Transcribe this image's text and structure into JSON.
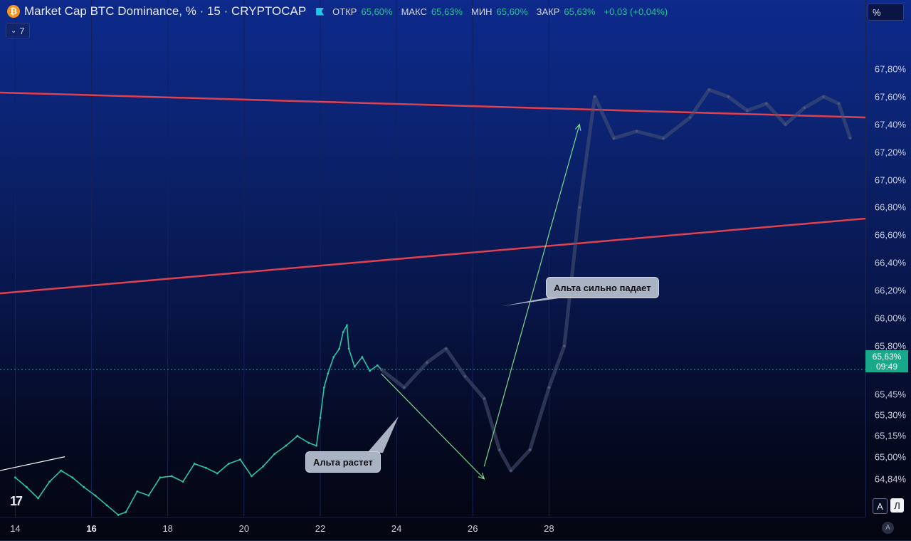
{
  "header": {
    "symbol_icon": "bitcoin-icon",
    "title": "Market Cap BTC Dominance, % · 15 · CRYPTOCAP",
    "open_label": "ОТКР",
    "open_value": "65,60%",
    "high_label": "МАКС",
    "high_value": "65,63%",
    "low_label": "МИН",
    "low_value": "65,60%",
    "close_label": "ЗАКР",
    "close_value": "65,63%",
    "change_value": "+0,03 (+0,04%)"
  },
  "indicators": {
    "count": "7",
    "toggle_icon": "chevron-down-icon"
  },
  "price_scale": {
    "unit_button": "%",
    "current_price": "65,63%",
    "countdown": "09:49",
    "auto_label": "A",
    "scale_buttons": [
      "A",
      "Л"
    ]
  },
  "annotations": {
    "alt_falls": "Альта сильно падает",
    "alt_rises": "Альта растет"
  },
  "colors": {
    "candle": "#2bc7a4",
    "projection": "#4a5577",
    "trendline": "#e0414f",
    "arrow": "#7ed98f",
    "price_tag": "#18a98a"
  },
  "chart_data": {
    "type": "line",
    "series": [
      {
        "values": [
          [
            14,
            64.85
          ],
          [
            14.3,
            64.78
          ],
          [
            14.6,
            64.7
          ],
          [
            14.9,
            64.82
          ],
          [
            15.2,
            64.9
          ],
          [
            15.5,
            64.85
          ],
          [
            15.8,
            64.78
          ],
          [
            16.1,
            64.72
          ],
          [
            16.4,
            64.65
          ],
          [
            16.7,
            64.58
          ],
          [
            16.9,
            64.6
          ],
          [
            17.2,
            64.75
          ],
          [
            17.5,
            64.72
          ],
          [
            17.8,
            64.85
          ],
          [
            18.1,
            64.86
          ],
          [
            18.4,
            64.82
          ],
          [
            18.7,
            64.95
          ],
          [
            19.0,
            64.92
          ],
          [
            19.3,
            64.88
          ],
          [
            19.6,
            64.95
          ],
          [
            19.9,
            64.98
          ],
          [
            20.2,
            64.86
          ],
          [
            20.5,
            64.93
          ],
          [
            20.8,
            65.02
          ],
          [
            21.1,
            65.08
          ],
          [
            21.4,
            65.15
          ],
          [
            21.7,
            65.1
          ],
          [
            21.9,
            65.08
          ],
          [
            22.0,
            65.28
          ],
          [
            22.1,
            65.5
          ],
          [
            22.2,
            65.6
          ],
          [
            22.35,
            65.72
          ],
          [
            22.5,
            65.78
          ],
          [
            22.6,
            65.9
          ],
          [
            22.7,
            65.95
          ],
          [
            22.75,
            65.78
          ],
          [
            22.9,
            65.65
          ],
          [
            23.1,
            65.72
          ],
          [
            23.3,
            65.62
          ],
          [
            23.5,
            65.66
          ],
          [
            23.6,
            65.63
          ]
        ]
      },
      {
        "values": [
          [
            23.6,
            65.63
          ],
          [
            24.2,
            65.5
          ],
          [
            24.8,
            65.68
          ],
          [
            25.3,
            65.78
          ],
          [
            25.8,
            65.58
          ],
          [
            26.3,
            65.42
          ],
          [
            26.7,
            65.05
          ],
          [
            27.0,
            64.9
          ],
          [
            27.5,
            65.05
          ],
          [
            28.0,
            65.5
          ],
          [
            28.4,
            65.8
          ],
          [
            28.8,
            66.8
          ],
          [
            29.2,
            67.6
          ],
          [
            29.7,
            67.3
          ],
          [
            30.3,
            67.35
          ],
          [
            31.0,
            67.3
          ],
          [
            31.7,
            67.45
          ],
          [
            32.2,
            67.65
          ],
          [
            32.7,
            67.6
          ],
          [
            33.2,
            67.5
          ],
          [
            33.7,
            67.55
          ],
          [
            34.2,
            67.4
          ],
          [
            34.7,
            67.52
          ],
          [
            35.2,
            67.6
          ],
          [
            35.6,
            67.55
          ],
          [
            35.9,
            67.3
          ]
        ]
      }
    ],
    "xlim": [
      13.6,
      36.3
    ],
    "ylim": [
      64.7,
      68.0
    ],
    "x_ticks": [
      "14",
      "16",
      "18",
      "20",
      "22",
      "24",
      "26",
      "28"
    ],
    "y_ticks": [
      "67,80%",
      "67,60%",
      "67,40%",
      "67,20%",
      "67,00%",
      "66,80%",
      "66,60%",
      "66,40%",
      "66,20%",
      "66,00%",
      "65,80%",
      "65,45%",
      "65,30%",
      "65,15%",
      "65,00%",
      "64,84%"
    ],
    "trendlines": [
      {
        "from": [
          13.6,
          67.63
        ],
        "to": [
          36.3,
          67.45
        ]
      },
      {
        "from": [
          13.6,
          66.18
        ],
        "to": [
          36.3,
          66.72
        ]
      },
      {
        "from": [
          13.6,
          64.9
        ],
        "to": [
          15.3,
          65.0
        ]
      }
    ],
    "arrows": [
      {
        "from": [
          23.6,
          65.6
        ],
        "to": [
          26.3,
          64.84
        ]
      },
      {
        "from": [
          26.3,
          64.93
        ],
        "to": [
          28.8,
          67.4
        ]
      }
    ],
    "current_value": 65.63
  }
}
